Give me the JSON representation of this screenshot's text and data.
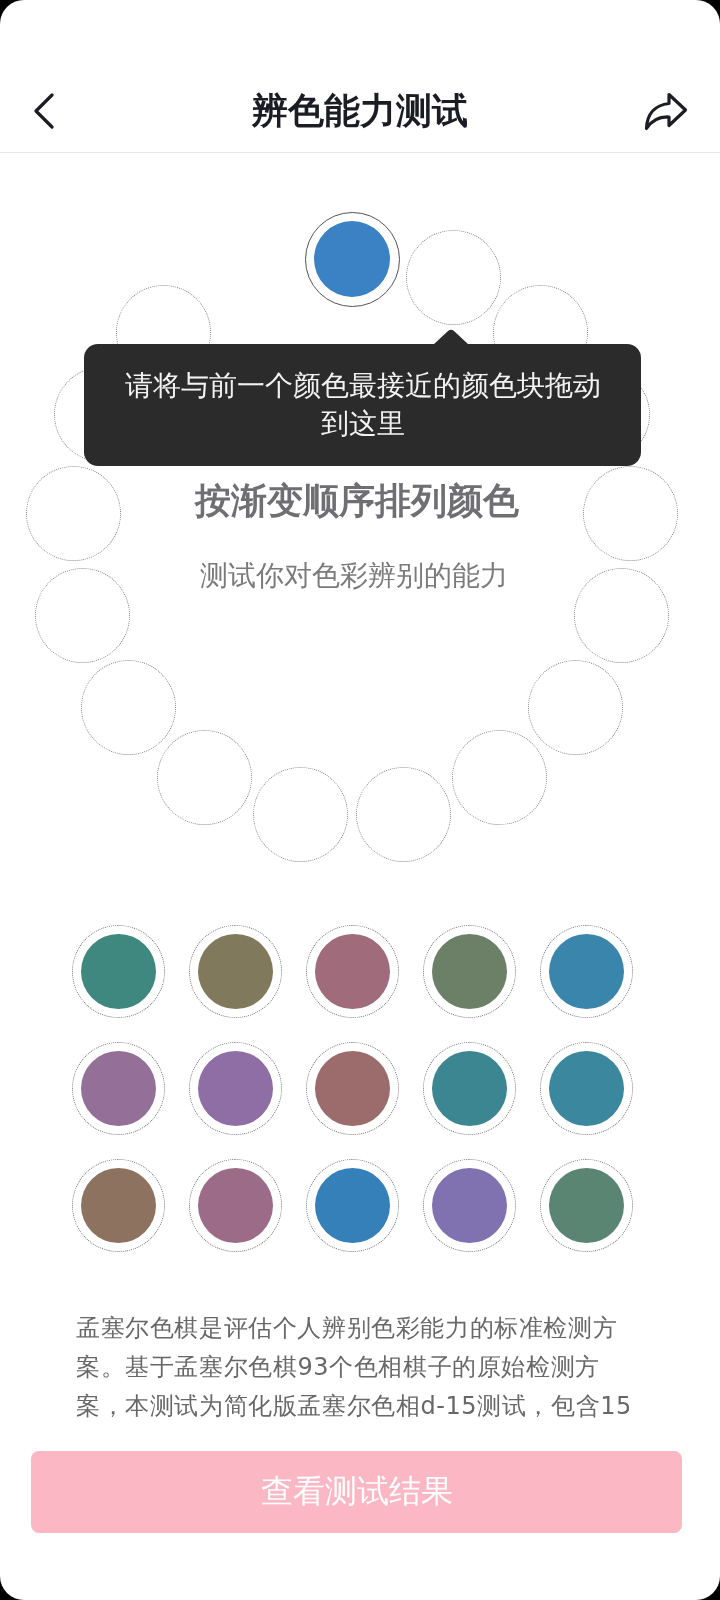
{
  "header": {
    "title": "辨色能力测试"
  },
  "ring": {
    "slots": [
      {
        "filled": true,
        "color": "#3a82c4"
      },
      {
        "filled": false
      },
      {
        "filled": false
      },
      {
        "filled": false
      },
      {
        "filled": false
      },
      {
        "filled": false
      },
      {
        "filled": false
      },
      {
        "filled": false
      },
      {
        "filled": false
      },
      {
        "filled": false
      },
      {
        "filled": false
      },
      {
        "filled": false
      },
      {
        "filled": false
      },
      {
        "filled": false
      },
      {
        "filled": false
      },
      {
        "filled": false
      }
    ]
  },
  "tooltip": {
    "text": "请将与前一个颜色最接近的颜色块拖动到这里"
  },
  "instructions": {
    "title": "按渐变顺序排列颜色",
    "subtitle": "测试你对色彩辨别的能力"
  },
  "palette": [
    {
      "color": "#3e8880"
    },
    {
      "color": "#80795b"
    },
    {
      "color": "#a06b7a"
    },
    {
      "color": "#6b8066"
    },
    {
      "color": "#3a85ab"
    },
    {
      "color": "#946f98"
    },
    {
      "color": "#8f6ea5"
    },
    {
      "color": "#9c6b6b"
    },
    {
      "color": "#3b8690"
    },
    {
      "color": "#3a879e"
    },
    {
      "color": "#8d735f"
    },
    {
      "color": "#9b6b88"
    },
    {
      "color": "#3580b8"
    },
    {
      "color": "#8072b0"
    },
    {
      "color": "#5a8573"
    }
  ],
  "description": "孟塞尔色棋是评估个人辨别色彩能力的标准检测方案。基于孟塞尔色棋93个色相棋子的原始检测方案，本测试为简化版孟塞尔色相d-15测试，包含15",
  "result_button": {
    "label": "查看测试结果",
    "disabled": true
  }
}
